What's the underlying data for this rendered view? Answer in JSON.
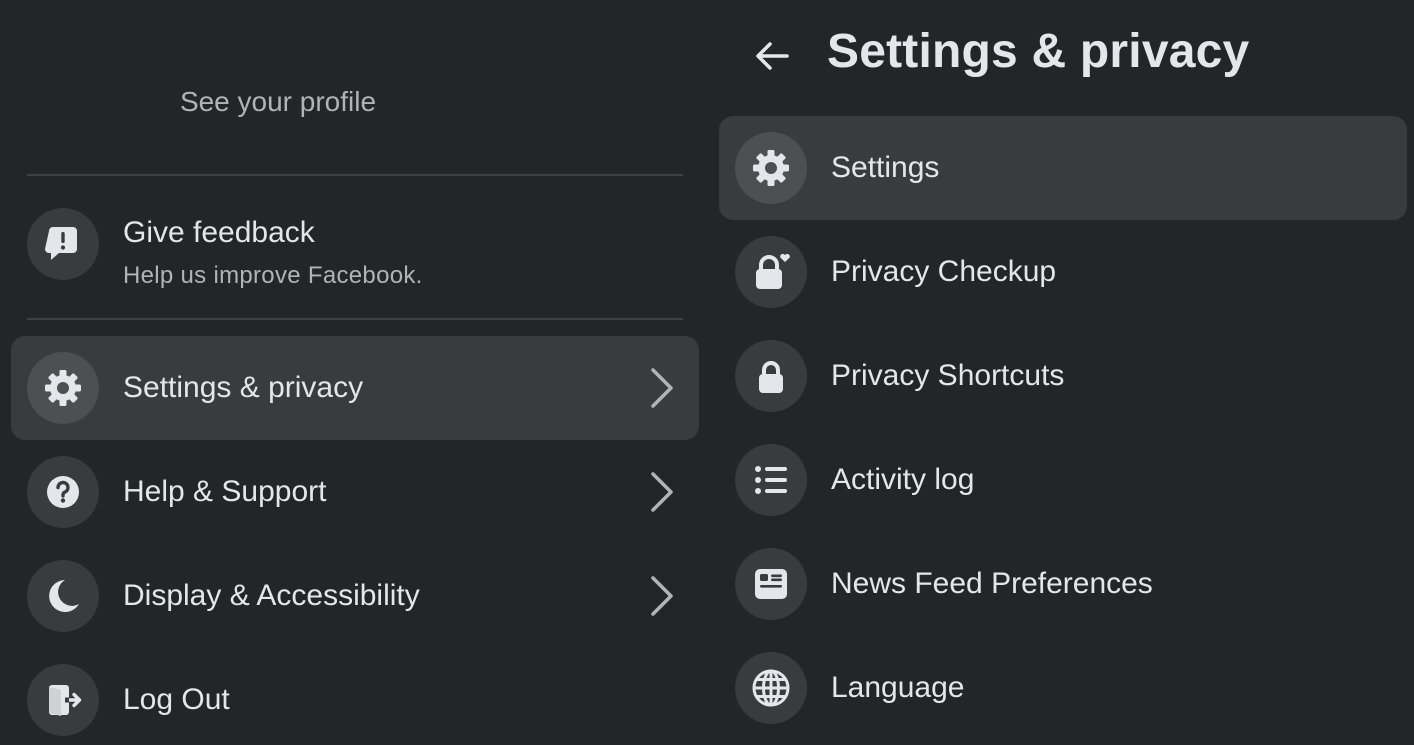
{
  "left_menu": {
    "see_profile": "See your profile",
    "feedback": {
      "title": "Give feedback",
      "subtitle": "Help us improve Facebook.",
      "icon": "feedback-icon"
    },
    "items": [
      {
        "label": "Settings & privacy",
        "icon": "gear-icon",
        "has_chevron": true,
        "active": true
      },
      {
        "label": "Help & Support",
        "icon": "question-icon",
        "has_chevron": true,
        "active": false
      },
      {
        "label": "Display & Accessibility",
        "icon": "moon-icon",
        "has_chevron": true,
        "active": false
      },
      {
        "label": "Log Out",
        "icon": "logout-icon",
        "has_chevron": false,
        "active": false
      }
    ]
  },
  "settings_panel": {
    "title": "Settings & privacy",
    "back_icon": "back-arrow-icon",
    "items": [
      {
        "label": "Settings",
        "icon": "gear-icon",
        "active": true
      },
      {
        "label": "Privacy Checkup",
        "icon": "lock-heart-icon",
        "active": false
      },
      {
        "label": "Privacy Shortcuts",
        "icon": "lock-icon",
        "active": false
      },
      {
        "label": "Activity log",
        "icon": "list-icon",
        "active": false
      },
      {
        "label": "News Feed Preferences",
        "icon": "news-feed-icon",
        "active": false
      },
      {
        "label": "Language",
        "icon": "globe-icon",
        "active": false
      }
    ]
  },
  "colors": {
    "background": "#242527",
    "hover_row": "#3a3b3c",
    "icon_circle": "#3a3b3c",
    "primary_text": "#e4e6eb",
    "secondary_text": "#b0b3b8",
    "divider": "#3e4042"
  }
}
